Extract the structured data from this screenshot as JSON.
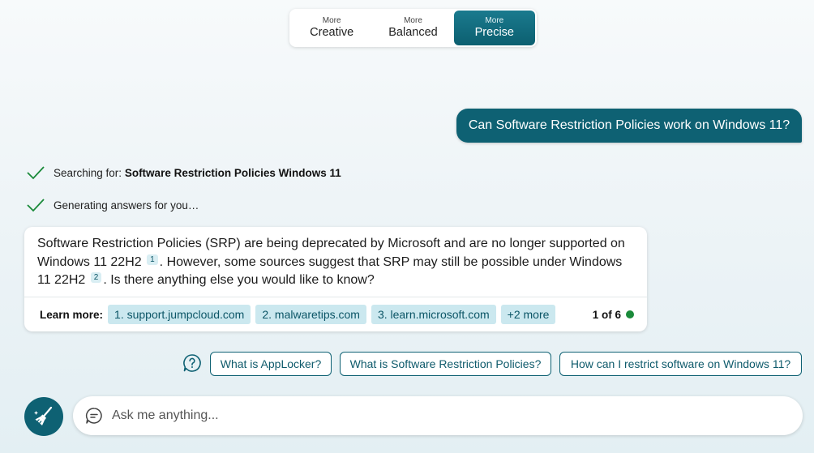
{
  "tones": [
    {
      "small": "More",
      "big": "Creative",
      "active": false
    },
    {
      "small": "More",
      "big": "Balanced",
      "active": false
    },
    {
      "small": "More",
      "big": "Precise",
      "active": true
    }
  ],
  "user_message": "Can Software Restriction Policies work on Windows 11?",
  "status": {
    "searching_prefix": "Searching for: ",
    "searching_query": "Software Restriction Policies Windows 11",
    "generating": "Generating answers for you…"
  },
  "answer": {
    "part1": "Software Restriction Policies (SRP) are being deprecated by Microsoft and are no longer supported on Windows 11 22H2",
    "cite1": "1",
    "part2": ". However, some sources suggest that SRP may still be possible under Windows 11 22H2",
    "cite2": "2",
    "part3": ". Is there anything else you would like to know?"
  },
  "learn_more": {
    "label": "Learn more:",
    "sources": [
      "1. support.jumpcloud.com",
      "2. malwaretips.com",
      "3. learn.microsoft.com",
      "+2 more"
    ],
    "pager": "1 of 6"
  },
  "suggestions": [
    "What is AppLocker?",
    "What is Software Restriction Policies?",
    "How can I restrict software on Windows 11?"
  ],
  "input": {
    "placeholder": "Ask me anything..."
  },
  "colors": {
    "accent": "#0e6173",
    "status_dot": "#1a8a3a",
    "chip_bg": "#cbe8ef"
  },
  "icons": {
    "check": "check-icon",
    "help": "question-icon",
    "new_topic": "broom-icon",
    "chat": "chat-bubble-icon"
  }
}
